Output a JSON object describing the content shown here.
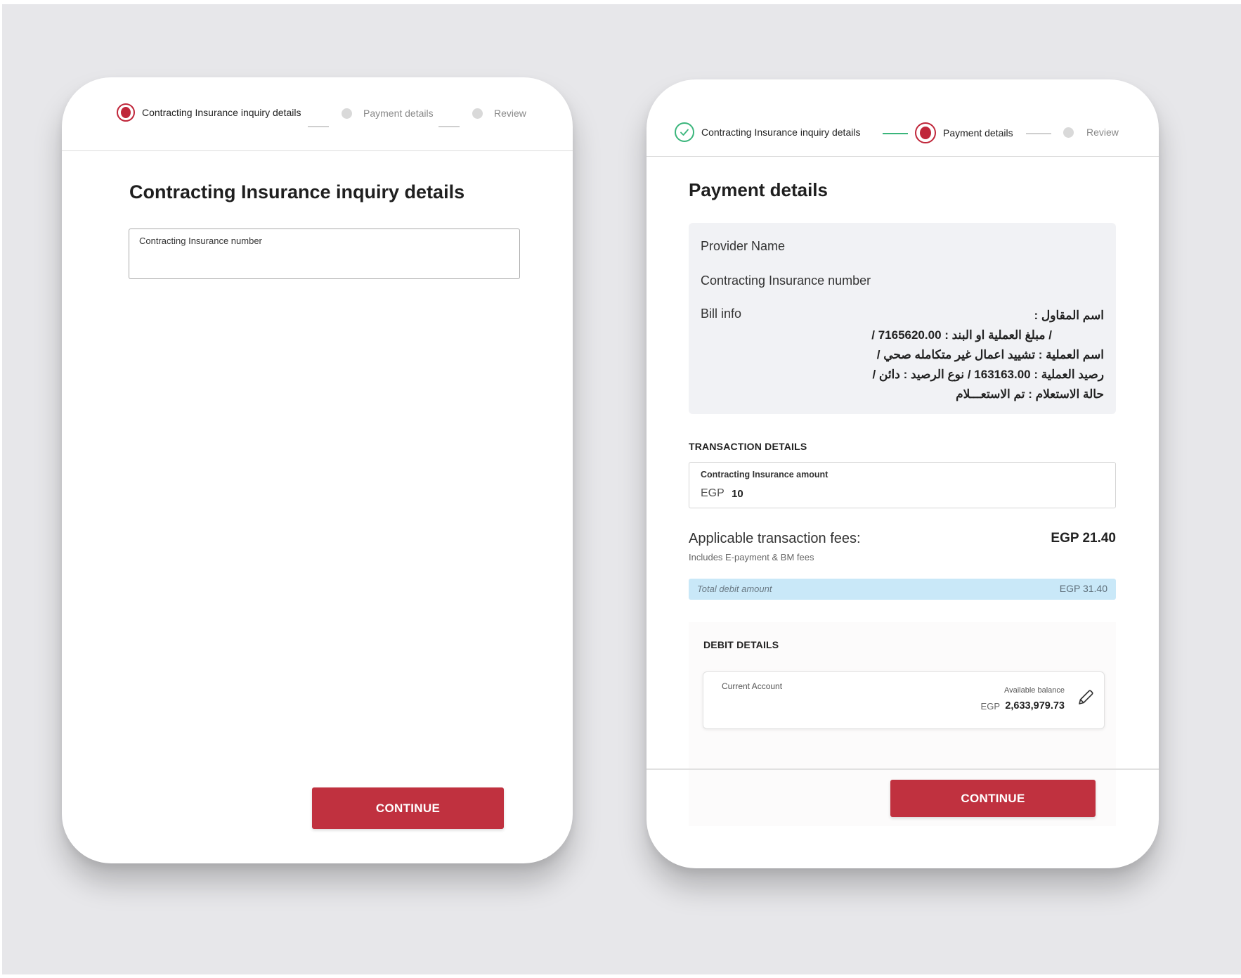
{
  "left": {
    "stepper": {
      "steps": [
        {
          "label": "Contracting Insurance inquiry details",
          "state": "active"
        },
        {
          "label": "Payment details",
          "state": "idle"
        },
        {
          "label": "Review",
          "state": "idle"
        }
      ]
    },
    "title": "Contracting Insurance inquiry details",
    "insurance_number_field": {
      "label": "Contracting Insurance number",
      "value": ""
    },
    "continue_label": "CONTINUE"
  },
  "right": {
    "stepper": {
      "steps": [
        {
          "label": "Contracting Insurance inquiry details",
          "state": "done"
        },
        {
          "label": "Payment details",
          "state": "active"
        },
        {
          "label": "Review",
          "state": "idle"
        }
      ]
    },
    "title": "Payment details",
    "info": {
      "provider_label": "Provider Name",
      "insurance_number_label": "Contracting Insurance number",
      "bill_info_label": "Bill info",
      "bill_lines": [
        "اسم المقاول :",
        "/ مبلغ العملية او البند : 7165620.00 /",
        "اسم العملية : تشييد اعمال غير متكامله صحي /",
        "رصيد العملية : 163163.00 / نوع الرصيد : دائن /",
        "حالة الاستعلام : تم الاستعـــلام"
      ]
    },
    "transaction": {
      "heading": "TRANSACTION DETAILS",
      "amount_label": "Contracting Insurance amount",
      "currency": "EGP",
      "amount": "10"
    },
    "fees": {
      "label": "Applicable transaction fees:",
      "sub": "Includes E-payment & BM fees",
      "value": "EGP 21.40"
    },
    "total": {
      "label": "Total debit amount",
      "value": "EGP 31.40"
    },
    "debit": {
      "heading": "DEBIT DETAILS",
      "account_type": "Current Account",
      "balance_label": "Available balance",
      "balance_currency": "EGP",
      "balance_value": "2,633,979.73"
    },
    "continue_label": "CONTINUE"
  },
  "colors": {
    "accent": "#c0313f",
    "success": "#3ab57b",
    "total_bar": "#c9e8f8",
    "backdrop": "#e7e7ea"
  },
  "icons": [
    "check-icon",
    "pencil-icon"
  ]
}
